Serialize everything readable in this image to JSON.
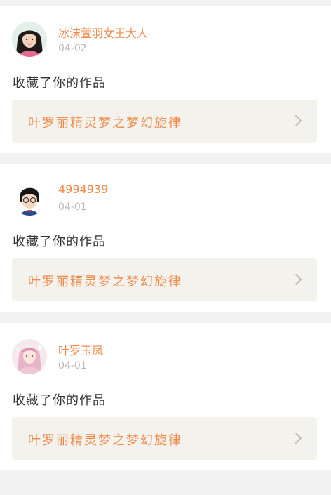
{
  "feed": {
    "items": [
      {
        "name": "冰沫萱羽女王大人",
        "date": "04-02",
        "action": "收藏了你的作品",
        "work_title": "叶罗丽精灵梦之梦幻旋律",
        "avatar_icon": "user-avatar-girl-photo"
      },
      {
        "name": "4994939",
        "date": "04-01",
        "action": "收藏了你的作品",
        "work_title": "叶罗丽精灵梦之梦幻旋律",
        "avatar_icon": "user-avatar-cartoon-boy"
      },
      {
        "name": "叶罗玉凤",
        "date": "04-01",
        "action": "收藏了你的作品",
        "work_title": "叶罗丽精灵梦之梦幻旋律",
        "avatar_icon": "user-avatar-anime-fairy"
      }
    ],
    "colors": {
      "accent": "#f08a4b",
      "date_gray": "#b7b7b7",
      "card_bg": "#ffffff",
      "separator_bg": "#f2f2f2",
      "work_box_bg": "#f3f2ec"
    }
  }
}
